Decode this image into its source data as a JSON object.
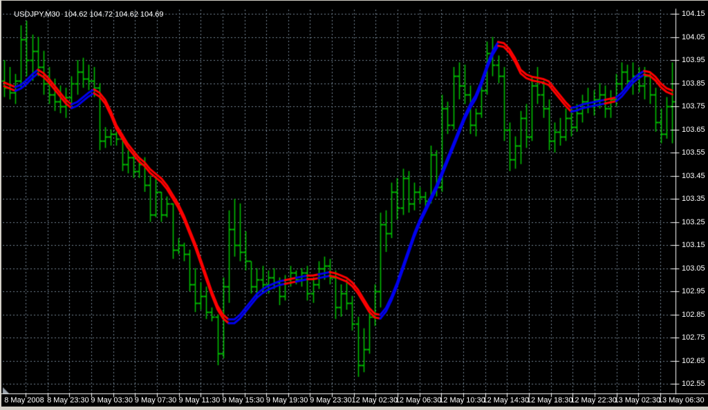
{
  "window": {
    "title_text": "USDJPY,M30  104.62 104.72 104.62 104.69"
  },
  "colors": {
    "background": "#000000",
    "frame": "#D4D0C8",
    "grid": "#778899",
    "bar_green": "#00BE00",
    "ribbon_up_blue": "#0000EE",
    "ribbon_down_red": "#FF0000",
    "axis_white": "#FFFFFF"
  },
  "chart_data": {
    "type": "bar",
    "subtype": "ohlc-bars-with-trend-ribbon",
    "symbol": "USDJPY",
    "period": "M30",
    "quote_open_high_low_close": "104.62 104.72 104.62 104.69",
    "y_axis": {
      "side": "right",
      "step": 0.1,
      "ylim": [
        102.55,
        104.15
      ],
      "labels": [
        "104.15",
        "104.05",
        "103.95",
        "103.85",
        "103.75",
        "103.65",
        "103.55",
        "103.45",
        "103.35",
        "103.25",
        "103.15",
        "103.05",
        "102.95",
        "102.85",
        "102.75",
        "102.65",
        "102.55"
      ]
    },
    "x_axis": {
      "side": "bottom",
      "labels": [
        "8 May 2008",
        "8 May 23:30",
        "9 May 03:30",
        "9 May 07:30",
        "9 May 11:30",
        "9 May 15:30",
        "9 May 19:30",
        "9 May 23:30",
        "12 May 02:30",
        "12 May 06:30",
        "12 May 10:30",
        "12 May 14:30",
        "12 May 18:30",
        "12 May 22:30",
        "13 May 02:30",
        "13 May 06:30"
      ]
    },
    "grid": {
      "visible": true,
      "style": "dashed"
    },
    "bars_ohlc": [
      [
        103.86,
        103.95,
        103.79,
        103.83
      ],
      [
        103.83,
        103.92,
        103.78,
        103.81
      ],
      [
        103.81,
        103.89,
        103.76,
        103.86
      ],
      [
        103.86,
        104.1,
        103.83,
        104.04
      ],
      [
        104.04,
        104.12,
        103.88,
        103.95
      ],
      [
        103.95,
        104.06,
        103.86,
        103.99
      ],
      [
        103.99,
        104.05,
        103.88,
        103.92
      ],
      [
        103.92,
        103.99,
        103.8,
        103.85
      ],
      [
        103.85,
        103.92,
        103.76,
        103.8
      ],
      [
        103.8,
        103.87,
        103.73,
        103.77
      ],
      [
        103.77,
        103.84,
        103.72,
        103.75
      ],
      [
        103.75,
        103.83,
        103.7,
        103.79
      ],
      [
        103.79,
        103.88,
        103.75,
        103.85
      ],
      [
        103.85,
        103.95,
        103.8,
        103.9
      ],
      [
        103.9,
        103.96,
        103.83,
        103.87
      ],
      [
        103.87,
        103.93,
        103.82,
        103.86
      ],
      [
        103.86,
        103.92,
        103.79,
        103.83
      ],
      [
        103.83,
        103.85,
        103.56,
        103.6
      ],
      [
        103.6,
        103.66,
        103.57,
        103.62
      ],
      [
        103.62,
        103.65,
        103.58,
        103.63
      ],
      [
        103.63,
        103.64,
        103.58,
        103.61
      ],
      [
        103.61,
        103.63,
        103.47,
        103.5
      ],
      [
        103.5,
        103.56,
        103.46,
        103.53
      ],
      [
        103.53,
        103.55,
        103.44,
        103.47
      ],
      [
        103.47,
        103.52,
        103.44,
        103.5
      ],
      [
        103.5,
        103.53,
        103.38,
        103.41
      ],
      [
        103.41,
        103.45,
        103.25,
        103.28
      ],
      [
        103.28,
        103.44,
        103.27,
        103.38
      ],
      [
        103.38,
        103.38,
        103.25,
        103.28
      ],
      [
        103.28,
        103.36,
        103.27,
        103.33
      ],
      [
        103.33,
        103.33,
        103.09,
        103.13
      ],
      [
        103.13,
        103.18,
        103.11,
        103.15
      ],
      [
        103.15,
        103.16,
        103.08,
        103.11
      ],
      [
        103.11,
        103.13,
        102.95,
        102.98
      ],
      [
        102.98,
        103.05,
        102.86,
        102.9
      ],
      [
        102.9,
        102.99,
        102.87,
        102.93
      ],
      [
        102.93,
        102.97,
        102.83,
        102.86
      ],
      [
        102.86,
        102.88,
        102.82,
        102.84
      ],
      [
        102.84,
        102.85,
        102.63,
        102.68
      ],
      [
        102.68,
        103.01,
        102.66,
        102.97
      ],
      [
        102.97,
        103.3,
        102.9,
        103.22
      ],
      [
        103.22,
        103.35,
        103.1,
        103.15
      ],
      [
        103.15,
        103.33,
        103.08,
        103.12
      ],
      [
        103.12,
        103.21,
        103.04,
        103.08
      ],
      [
        103.08,
        103.08,
        102.94,
        102.97
      ],
      [
        102.97,
        103.05,
        102.92,
        103.0
      ],
      [
        103.0,
        103.06,
        102.95,
        102.98
      ],
      [
        102.98,
        103.04,
        102.94,
        103.01
      ],
      [
        103.01,
        103.05,
        102.96,
        102.99
      ],
      [
        102.99,
        103.01,
        102.89,
        102.93
      ],
      [
        102.93,
        103.02,
        102.91,
        103.0
      ],
      [
        103.0,
        103.06,
        102.97,
        103.03
      ],
      [
        103.03,
        103.04,
        102.98,
        103.0
      ],
      [
        103.0,
        103.05,
        102.97,
        103.03
      ],
      [
        103.03,
        103.06,
        102.91,
        102.94
      ],
      [
        102.94,
        103.01,
        102.9,
        102.98
      ],
      [
        102.98,
        103.08,
        102.96,
        103.05
      ],
      [
        103.05,
        103.1,
        103.0,
        103.06
      ],
      [
        103.06,
        103.09,
        102.98,
        103.01
      ],
      [
        103.01,
        103.04,
        102.83,
        102.88
      ],
      [
        102.88,
        102.98,
        102.84,
        102.94
      ],
      [
        102.94,
        103.0,
        102.87,
        102.9
      ],
      [
        102.9,
        102.93,
        102.78,
        102.81
      ],
      [
        102.81,
        102.84,
        102.58,
        102.63
      ],
      [
        102.63,
        102.79,
        102.6,
        102.7
      ],
      [
        102.7,
        102.88,
        102.68,
        102.84
      ],
      [
        102.84,
        102.98,
        102.8,
        102.95
      ],
      [
        102.95,
        103.29,
        102.88,
        103.24
      ],
      [
        103.24,
        103.3,
        103.12,
        103.2
      ],
      [
        103.2,
        103.42,
        103.18,
        103.38
      ],
      [
        103.38,
        103.44,
        103.26,
        103.31
      ],
      [
        103.31,
        103.48,
        103.28,
        103.44
      ],
      [
        103.44,
        103.47,
        103.29,
        103.33
      ],
      [
        103.33,
        103.42,
        103.3,
        103.38
      ],
      [
        103.38,
        103.4,
        103.33,
        103.36
      ],
      [
        103.36,
        103.38,
        103.31,
        103.34
      ],
      [
        103.34,
        103.58,
        103.33,
        103.54
      ],
      [
        103.54,
        103.56,
        103.36,
        103.4
      ],
      [
        103.4,
        103.8,
        103.38,
        103.74
      ],
      [
        103.74,
        103.77,
        103.63,
        103.67
      ],
      [
        103.67,
        103.92,
        103.65,
        103.88
      ],
      [
        103.88,
        103.94,
        103.78,
        103.84
      ],
      [
        103.84,
        103.93,
        103.76,
        103.8
      ],
      [
        103.8,
        103.84,
        103.63,
        103.67
      ],
      [
        103.67,
        103.74,
        103.62,
        103.72
      ],
      [
        103.72,
        103.86,
        103.7,
        103.82
      ],
      [
        103.82,
        104.03,
        103.8,
        103.98
      ],
      [
        103.98,
        104.05,
        103.88,
        103.93
      ],
      [
        103.93,
        103.97,
        103.85,
        103.88
      ],
      [
        103.88,
        103.92,
        103.6,
        103.65
      ],
      [
        103.65,
        103.68,
        103.47,
        103.52
      ],
      [
        103.52,
        103.62,
        103.48,
        103.58
      ],
      [
        103.58,
        103.73,
        103.5,
        103.7
      ],
      [
        103.7,
        103.76,
        103.57,
        103.62
      ],
      [
        103.62,
        103.88,
        103.6,
        103.84
      ],
      [
        103.84,
        103.92,
        103.76,
        103.8
      ],
      [
        103.8,
        103.86,
        103.7,
        103.74
      ],
      [
        103.74,
        103.78,
        103.56,
        103.6
      ],
      [
        103.6,
        103.68,
        103.55,
        103.64
      ],
      [
        103.64,
        103.7,
        103.58,
        103.62
      ],
      [
        103.62,
        103.74,
        103.6,
        103.7
      ],
      [
        103.7,
        103.74,
        103.62,
        103.66
      ],
      [
        103.66,
        103.76,
        103.64,
        103.72
      ],
      [
        103.72,
        103.8,
        103.68,
        103.77
      ],
      [
        103.77,
        103.83,
        103.72,
        103.75
      ],
      [
        103.75,
        103.82,
        103.71,
        103.78
      ],
      [
        103.78,
        103.85,
        103.74,
        103.8
      ],
      [
        103.8,
        103.84,
        103.7,
        103.74
      ],
      [
        103.74,
        103.82,
        103.7,
        103.78
      ],
      [
        103.78,
        103.89,
        103.75,
        103.85
      ],
      [
        103.85,
        103.94,
        103.82,
        103.9
      ],
      [
        103.9,
        103.93,
        103.83,
        103.86
      ],
      [
        103.86,
        103.94,
        103.8,
        103.88
      ],
      [
        103.88,
        103.92,
        103.81,
        103.84
      ],
      [
        103.84,
        103.92,
        103.78,
        103.88
      ],
      [
        103.88,
        103.9,
        103.76,
        103.8
      ],
      [
        103.8,
        103.83,
        103.64,
        103.68
      ],
      [
        103.68,
        103.74,
        103.59,
        103.63
      ],
      [
        103.63,
        103.79,
        103.61,
        103.75
      ],
      [
        103.75,
        103.94,
        103.59,
        103.77
      ]
    ],
    "indicator": {
      "name": "double-ma-trend-ribbon",
      "line_offset": 0.008,
      "values": [
        103.845,
        103.835,
        103.825,
        103.835,
        103.855,
        103.88,
        103.9,
        103.885,
        103.86,
        103.83,
        103.8,
        103.77,
        103.75,
        103.76,
        103.78,
        103.8,
        103.815,
        103.8,
        103.77,
        103.72,
        103.66,
        103.62,
        103.58,
        103.55,
        103.52,
        103.5,
        103.47,
        103.45,
        103.43,
        103.4,
        103.36,
        103.32,
        103.27,
        103.21,
        103.15,
        103.08,
        103.01,
        102.94,
        102.88,
        102.84,
        102.82,
        102.82,
        102.84,
        102.87,
        102.9,
        102.93,
        102.95,
        102.965,
        102.975,
        102.985,
        102.99,
        102.995,
        103.0,
        103.005,
        103.01,
        103.01,
        103.015,
        103.02,
        103.025,
        103.02,
        103.01,
        103.0,
        102.98,
        102.95,
        102.91,
        102.87,
        102.845,
        102.84,
        102.87,
        102.92,
        102.98,
        103.05,
        103.12,
        103.19,
        103.25,
        103.3,
        103.35,
        103.4,
        103.46,
        103.52,
        103.58,
        103.64,
        103.7,
        103.75,
        103.79,
        103.85,
        103.92,
        103.98,
        104.02,
        104.015,
        103.99,
        103.95,
        103.9,
        103.88,
        103.87,
        103.865,
        103.86,
        103.85,
        103.82,
        103.79,
        103.76,
        103.735,
        103.74,
        103.75,
        103.755,
        103.76,
        103.765,
        103.77,
        103.775,
        103.78,
        103.8,
        103.83,
        103.86,
        103.88,
        103.895,
        103.89,
        103.87,
        103.84,
        103.82,
        103.81
      ],
      "trend_segments": [
        {
          "start": 0,
          "end": 2,
          "dir": "down"
        },
        {
          "start": 2,
          "end": 6,
          "dir": "up"
        },
        {
          "start": 6,
          "end": 12,
          "dir": "down"
        },
        {
          "start": 12,
          "end": 16,
          "dir": "up"
        },
        {
          "start": 16,
          "end": 40,
          "dir": "down"
        },
        {
          "start": 40,
          "end": 50,
          "dir": "up"
        },
        {
          "start": 50,
          "end": 52,
          "dir": "down"
        },
        {
          "start": 52,
          "end": 54,
          "dir": "up"
        },
        {
          "start": 54,
          "end": 56,
          "dir": "down"
        },
        {
          "start": 56,
          "end": 58,
          "dir": "up"
        },
        {
          "start": 58,
          "end": 67,
          "dir": "down"
        },
        {
          "start": 67,
          "end": 88,
          "dir": "up"
        },
        {
          "start": 88,
          "end": 101,
          "dir": "down"
        },
        {
          "start": 101,
          "end": 107,
          "dir": "up"
        },
        {
          "start": 107,
          "end": 109,
          "dir": "down"
        },
        {
          "start": 109,
          "end": 114,
          "dir": "up"
        },
        {
          "start": 114,
          "end": 119,
          "dir": "down"
        }
      ]
    }
  }
}
